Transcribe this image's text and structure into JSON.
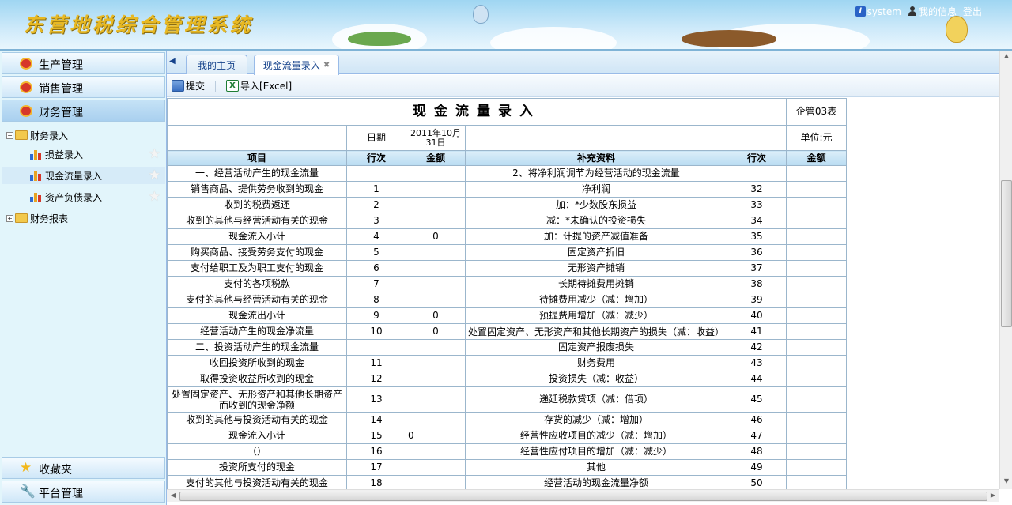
{
  "header": {
    "app_title": "东营地税综合管理系统",
    "user_name": "system",
    "my_info": "我的信息",
    "logout": "登出"
  },
  "sidebar": {
    "accordions": [
      {
        "label": "生产管理"
      },
      {
        "label": "销售管理"
      },
      {
        "label": "财务管理"
      }
    ],
    "tree": [
      {
        "label": "财务录入",
        "type": "folder",
        "expanded": true
      },
      {
        "label": "损益录入",
        "type": "leaf"
      },
      {
        "label": "现金流量录入",
        "type": "leaf",
        "selected": true
      },
      {
        "label": "资产负债录入",
        "type": "leaf"
      },
      {
        "label": "财务报表",
        "type": "folder",
        "expanded": false
      }
    ],
    "bottom": [
      {
        "label": "收藏夹",
        "icon": "star-icon"
      },
      {
        "label": "平台管理",
        "icon": "wrench-icon"
      }
    ]
  },
  "tabs": [
    {
      "label": "我的主页"
    },
    {
      "label": "现金流量录入",
      "active": true
    }
  ],
  "toolbar": {
    "submit": "提交",
    "import": "导入[Excel]"
  },
  "report": {
    "title": "现金流量录入",
    "form_code": "企管03表",
    "date_label": "日期",
    "date_value": "2011年10月31日",
    "unit": "单位:元",
    "columns": [
      "项目",
      "行次",
      "金额",
      "补充资料",
      "行次",
      "金额"
    ],
    "rows": [
      [
        "一、经营活动产生的现金流量",
        "",
        "",
        "2、将净利润调节为经营活动的现金流量",
        "",
        ""
      ],
      [
        "销售商品、提供劳务收到的现金",
        "1",
        "",
        "净利润",
        "32",
        ""
      ],
      [
        "收到的税费返还",
        "2",
        "",
        "加：*少数股东损益",
        "33",
        ""
      ],
      [
        "收到的其他与经营活动有关的现金",
        "3",
        "",
        "减：*未确认的投资损失",
        "34",
        ""
      ],
      [
        "现金流入小计",
        "4",
        "0",
        "加：计提的资产减值准备",
        "35",
        ""
      ],
      [
        "购买商品、接受劳务支付的现金",
        "5",
        "",
        "固定资产折旧",
        "36",
        ""
      ],
      [
        "支付给职工及为职工支付的现金",
        "6",
        "",
        "无形资产摊销",
        "37",
        ""
      ],
      [
        "支付的各项税款",
        "7",
        "",
        "长期待摊费用摊销",
        "38",
        ""
      ],
      [
        "支付的其他与经营活动有关的现金",
        "8",
        "",
        "待摊费用减少（减：增加）",
        "39",
        ""
      ],
      [
        "现金流出小计",
        "9",
        "0",
        "预提费用增加（减：减少）",
        "40",
        ""
      ],
      [
        "经营活动产生的现金净流量",
        "10",
        "0",
        "处置固定资产、无形资产和其他长期资产的损失（减：收益）",
        "41",
        ""
      ],
      [
        "二、投资活动产生的现金流量",
        "",
        "",
        "固定资产报废损失",
        "42",
        ""
      ],
      [
        "收回投资所收到的现金",
        "11",
        "",
        "财务费用",
        "43",
        ""
      ],
      [
        "取得投资收益所收到的现金",
        "12",
        "",
        "投资损失（减：收益）",
        "44",
        ""
      ],
      [
        "处置固定资产、无形资产和其他长期资产而收到的现金净额",
        "13",
        "",
        "递延税款贷项（减：借项）",
        "45",
        ""
      ],
      [
        "收到的其他与投资活动有关的现金",
        "14",
        "",
        "存货的减少（减：增加）",
        "46",
        ""
      ],
      [
        "现金流入小计",
        "15",
        "0",
        "经营性应收项目的减少（减：增加）",
        "47",
        ""
      ],
      [
        "（）",
        "16",
        "",
        "经营性应付项目的增加（减：减少）",
        "48",
        ""
      ],
      [
        "投资所支付的现金",
        "17",
        "",
        "其他",
        "49",
        ""
      ],
      [
        "支付的其他与投资活动有关的现金",
        "18",
        "",
        "经营活动的现金流量净额",
        "50",
        ""
      ]
    ]
  }
}
